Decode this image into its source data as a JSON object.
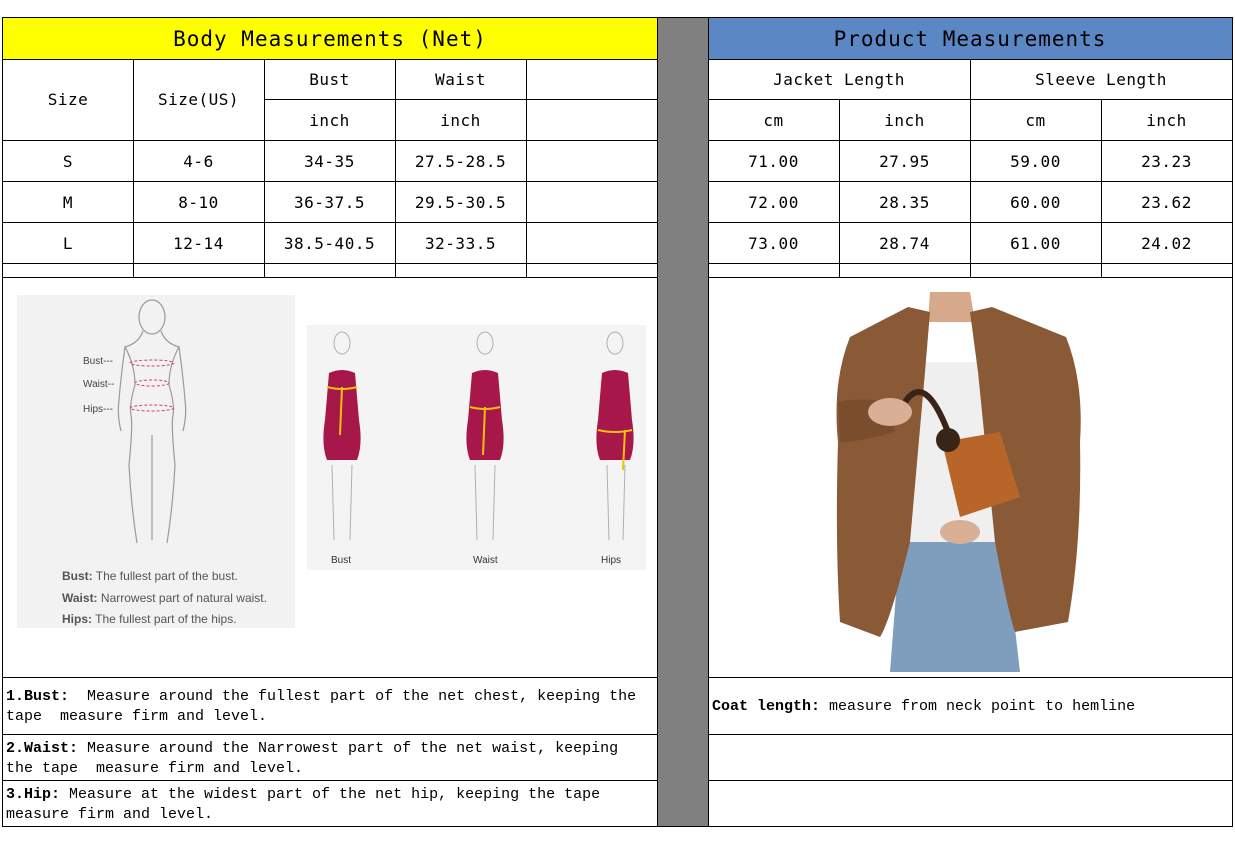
{
  "header": {
    "body_title": "Body Measurements (Net)",
    "product_title": "Product Measurements",
    "body_bg": "#ffff00",
    "product_bg": "#5b87c5",
    "divider_bg": "#808080"
  },
  "body_table": {
    "col_size": "Size",
    "col_size_us": "Size(US)",
    "col_bust": "Bust",
    "col_waist": "Waist",
    "unit_bust": "inch",
    "unit_waist": "inch",
    "rows": [
      {
        "size": "S",
        "size_us": "4-6",
        "bust": "34-35",
        "waist": "27.5-28.5"
      },
      {
        "size": "M",
        "size_us": "8-10",
        "bust": "36-37.5",
        "waist": "29.5-30.5"
      },
      {
        "size": "L",
        "size_us": "12-14",
        "bust": "38.5-40.5",
        "waist": "32-33.5"
      }
    ]
  },
  "product_table": {
    "col_jacket": "Jacket Length",
    "col_sleeve": "Sleeve Length",
    "units": [
      "cm",
      "inch",
      "cm",
      "inch"
    ],
    "rows": [
      {
        "jacket_cm": "71.00",
        "jacket_inch": "27.95",
        "sleeve_cm": "59.00",
        "sleeve_inch": "23.23"
      },
      {
        "jacket_cm": "72.00",
        "jacket_inch": "28.35",
        "sleeve_cm": "60.00",
        "sleeve_inch": "23.62"
      },
      {
        "jacket_cm": "73.00",
        "jacket_inch": "28.74",
        "sleeve_cm": "61.00",
        "sleeve_inch": "24.02"
      }
    ]
  },
  "diagram": {
    "labels": {
      "bust": "Bust---",
      "waist": "Waist--",
      "hips": "Hips---"
    },
    "legend": [
      {
        "term": "Bust:",
        "desc": "The fullest part of the bust."
      },
      {
        "term": "Waist:",
        "desc": "Narrowest part of natural waist."
      },
      {
        "term": "Hips:",
        "desc": "The fullest part of the hips."
      }
    ],
    "dress_captions": [
      "Bust",
      "Waist",
      "Hips"
    ],
    "dress_color": "#a8174a",
    "tape_color": "#f4c20d"
  },
  "notes": {
    "bust_term": "1.Bust:",
    "bust_text": "  Measure around the fullest part of the net chest, keeping the tape  measure firm and level.",
    "waist_term": "2.Waist:",
    "waist_text": " Measure around the Narrowest part of the net waist, keeping the tape  measure firm and level.",
    "hip_term": "3.Hip:",
    "hip_text": " Measure at the widest part of the net hip, keeping the tape measure firm and level.",
    "coat_term": "Coat length:",
    "coat_text": " measure from neck point to hemline"
  },
  "photo": {
    "jacket_color": "#8a5a36",
    "bag_color": "#b8652a",
    "jeans_color": "#7f9dbd"
  }
}
